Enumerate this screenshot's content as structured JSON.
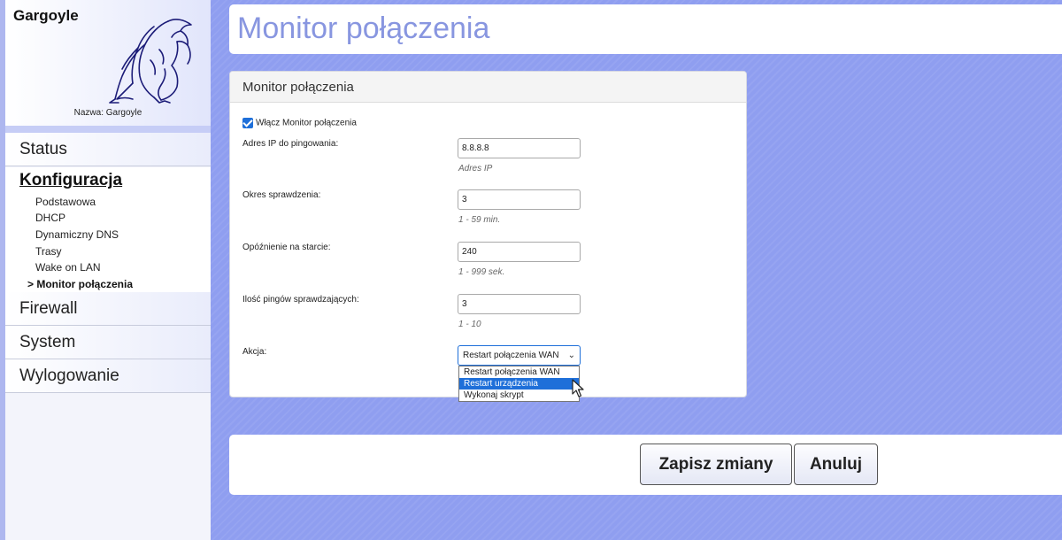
{
  "sidebar": {
    "brand": "Gargoyle",
    "device_name": "Nazwa: Gargoyle",
    "nav": {
      "status": "Status",
      "config": "Konfiguracja",
      "config_items": [
        "Podstawowa",
        "DHCP",
        "Dynamiczny DNS",
        "Trasy",
        "Wake on LAN",
        "> Monitor połączenia"
      ],
      "firewall": "Firewall",
      "system": "System",
      "logout": "Wylogowanie"
    }
  },
  "page": {
    "title": "Monitor połączenia"
  },
  "panel": {
    "title": "Monitor połączenia",
    "enable_label": "Włącz Monitor połączenia",
    "enable_checked": true,
    "fields": {
      "ping_ip": {
        "label": "Adres IP do pingowania:",
        "value": "8.8.8.8",
        "hint": "Adres IP"
      },
      "interval": {
        "label": "Okres sprawdzenia:",
        "value": "3",
        "hint": "1 - 59 min."
      },
      "startup_delay": {
        "label": "Opóźnienie na starcie:",
        "value": "240",
        "hint": "1 - 999 sek."
      },
      "ping_count": {
        "label": "Ilość pingów sprawdzających:",
        "value": "3",
        "hint": "1 - 10"
      }
    },
    "action": {
      "label": "Akcja:",
      "selected": "Restart połączenia WAN",
      "options": [
        "Restart połączenia WAN",
        "Restart urządzenia",
        "Wykonaj skrypt"
      ],
      "highlighted_option": "Restart urządzenia"
    }
  },
  "buttons": {
    "save": "Zapisz zmiany",
    "cancel": "Anuluj"
  },
  "colors": {
    "background": "#8f9ef0",
    "title_text": "#8896e0",
    "accent_blue": "#1e6fd9"
  }
}
